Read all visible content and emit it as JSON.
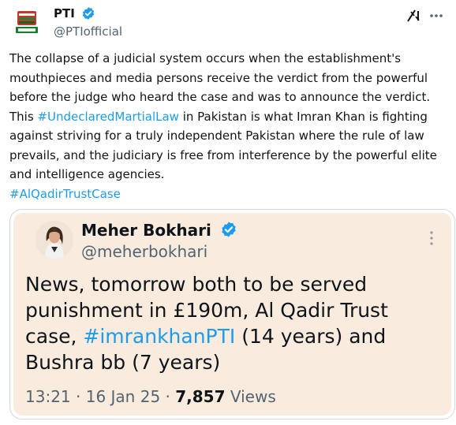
{
  "post": {
    "author_name": "PTI",
    "author_handle": "@PTIofficial",
    "text_parts": [
      "The collapse of a judicial system occurs when the establishment's mouthpieces and media persons receive the verdict from the powerful before the judge who heard the case and was to announce the verdict. This ",
      "#UndeclaredMartialLaw",
      " in Pakistan is what Imran Khan is fighting against striving for a truly independent Pakistan where the rule of law prevails, and the judiciary is free from interference by the powerful elite and intelligence agencies.",
      "#AlQadirTrustCase"
    ]
  },
  "quote": {
    "author_name": "Meher Bokhari",
    "author_handle": "@meherbokhari",
    "text_before": "News, tomorrow both to be served punishment in £190m, Al Qadir Trust case, ",
    "hashtag": "#imrankhanPTI",
    "text_after": " (14 years) and Bushra bb (7 years)",
    "time": "13:21",
    "sep": "·",
    "date": "16 Jan 25",
    "views_count": "7,857",
    "views_label": "Views"
  },
  "colors": {
    "link": "#1d9bf0",
    "verified": "#1d9bf0",
    "quote_bg": "#f9ebdd"
  },
  "icons": [
    "verified-icon",
    "grok-icon",
    "more-icon"
  ]
}
